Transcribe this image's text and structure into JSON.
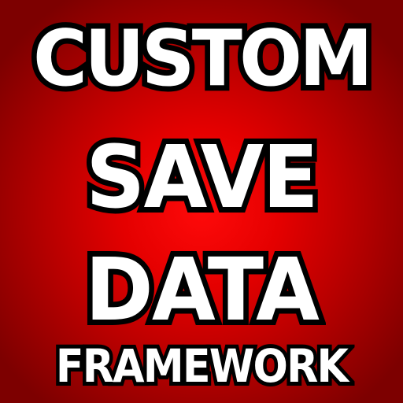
{
  "title_lines": {
    "line1": "CUSTOM",
    "line2": "SAVE",
    "line3": "DATA",
    "line4": "FRAMEWORK"
  },
  "colors": {
    "background_center": "#ff0a0a",
    "background_edge": "#7d0000",
    "text_fill": "#ffffff",
    "text_outline": "#000000"
  }
}
